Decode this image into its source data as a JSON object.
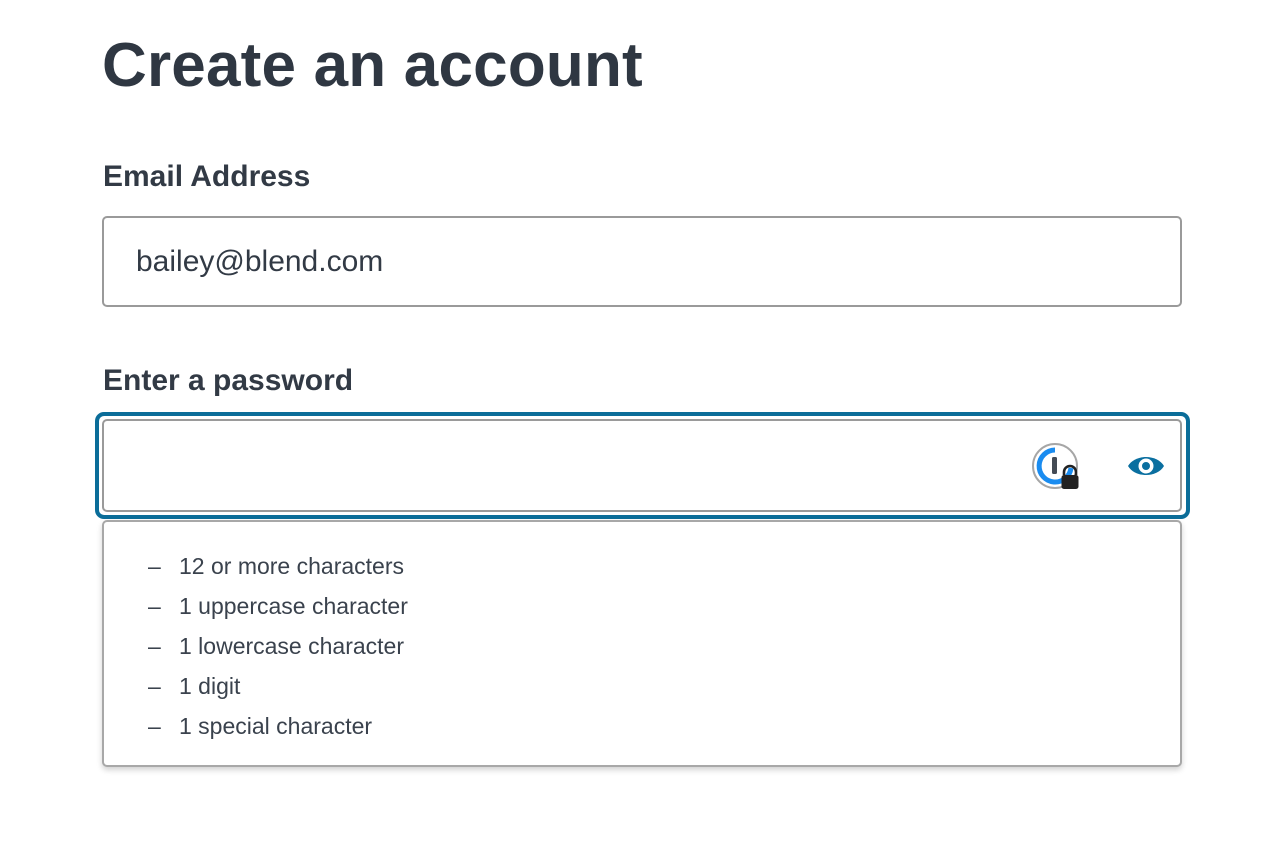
{
  "page": {
    "title": "Create an account"
  },
  "form": {
    "email": {
      "label": "Email Address",
      "value": "bailey@blend.com"
    },
    "password": {
      "label": "Enter a password",
      "value": "",
      "focused": true,
      "password_manager_icon": "password-manager-lock-icon",
      "toggle_icon": "eye-icon"
    },
    "requirements": {
      "bullet": "–",
      "items": [
        "12 or more characters",
        "1 uppercase character",
        "1 lowercase character",
        "1 digit",
        "1 special character"
      ]
    }
  },
  "colors": {
    "text": "#323a45",
    "border": "#9a9a9a",
    "focus": "#0b6d99",
    "accent": "#0a6fa0"
  }
}
